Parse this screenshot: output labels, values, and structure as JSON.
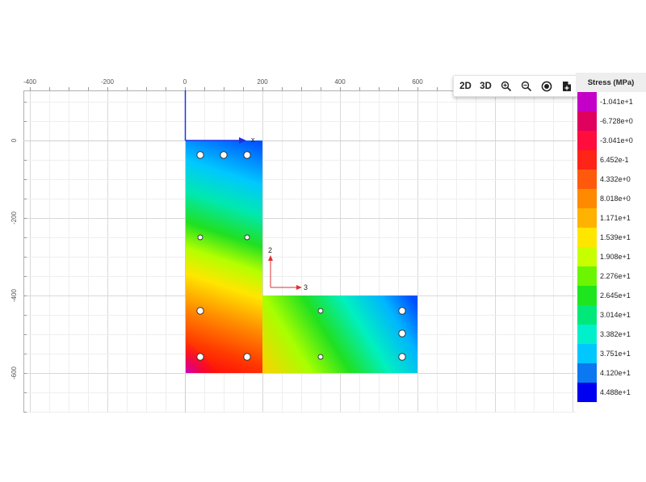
{
  "view": {
    "x_ticks": [
      "-400",
      "-200",
      "0",
      "200",
      "400",
      "600"
    ],
    "y_ticks": [
      "0",
      "-200",
      "-400",
      "-600"
    ],
    "section_axis_x_label": "x",
    "local_axis_2_label": "2",
    "local_axis_3_label": "3"
  },
  "toolbar": {
    "view_2d_label": "2D",
    "view_3d_label": "3D",
    "zoom_in_icon": "zoom-in-icon",
    "zoom_out_icon": "zoom-out-icon",
    "center_icon": "target-icon",
    "export_icon": "export-file-icon"
  },
  "legend": {
    "title": "Stress (MPa)",
    "items": [
      {
        "label": "-1.041e+1",
        "color": "#c400c8"
      },
      {
        "label": "-6.728e+0",
        "color": "#e0005e"
      },
      {
        "label": "-3.041e+0",
        "color": "#ff0d3c"
      },
      {
        "label": "6.452e-1",
        "color": "#ff2418"
      },
      {
        "label": "4.332e+0",
        "color": "#ff5a0c"
      },
      {
        "label": "8.018e+0",
        "color": "#ff8a00"
      },
      {
        "label": "1.171e+1",
        "color": "#ffb200"
      },
      {
        "label": "1.539e+1",
        "color": "#ffe600"
      },
      {
        "label": "1.908e+1",
        "color": "#c8ff00"
      },
      {
        "label": "2.276e+1",
        "color": "#6cf500"
      },
      {
        "label": "2.645e+1",
        "color": "#1ee61e"
      },
      {
        "label": "3.014e+1",
        "color": "#00e87a"
      },
      {
        "label": "3.382e+1",
        "color": "#00f0cc"
      },
      {
        "label": "3.751e+1",
        "color": "#00c8ff"
      },
      {
        "label": "4.120e+1",
        "color": "#0a78f0"
      },
      {
        "label": "4.488e+1",
        "color": "#0000f0"
      }
    ]
  }
}
